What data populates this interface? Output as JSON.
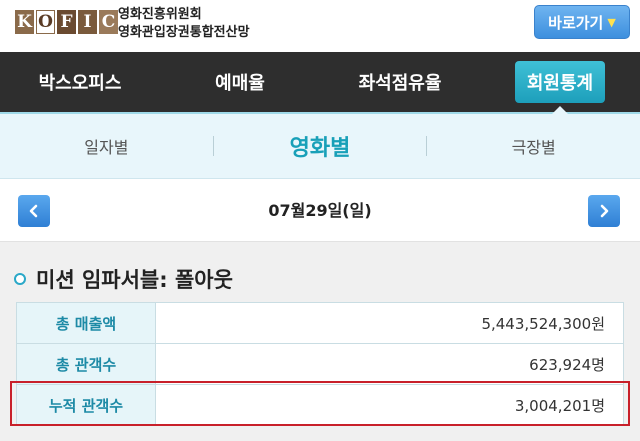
{
  "header": {
    "logo_letters": [
      "K",
      "O",
      "F",
      "I",
      "C"
    ],
    "org_line1": "영화진흥위원회",
    "org_line2": "영화관입장권통합전산망",
    "shortcut_label": "바로가기"
  },
  "main_nav": {
    "tabs": [
      {
        "label": "박스오피스",
        "active": false
      },
      {
        "label": "예매율",
        "active": false
      },
      {
        "label": "좌석점유율",
        "active": false
      },
      {
        "label": "회원통계",
        "active": true
      }
    ]
  },
  "sub_nav": {
    "tabs": [
      {
        "label": "일자별",
        "active": false
      },
      {
        "label": "영화별",
        "active": true
      },
      {
        "label": "극장별",
        "active": false
      }
    ]
  },
  "date_bar": {
    "date": "07월29일(일)",
    "prev_icon": "chevron-left-icon",
    "next_icon": "chevron-right-icon"
  },
  "movie": {
    "title": "미션 임파서블: 폴아웃",
    "stats": [
      {
        "label": "총 매출액",
        "value": "5,443,524,300원"
      },
      {
        "label": "총 관객수",
        "value": "623,924명"
      },
      {
        "label": "누적 관객수",
        "value": "3,004,201명",
        "highlighted": true
      }
    ]
  },
  "colors": {
    "accent": "#1d9fbb",
    "nav_bg": "#2e2e2e",
    "button_blue": "#3d8fde",
    "highlight_red": "#c8202a"
  }
}
